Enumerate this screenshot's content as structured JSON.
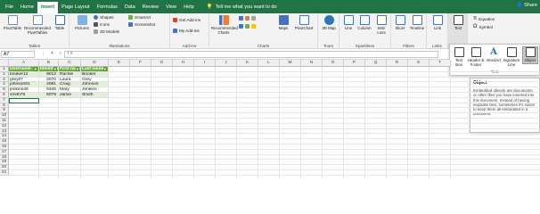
{
  "tabs": [
    "File",
    "Home",
    "Insert",
    "Page Layout",
    "Formulas",
    "Data",
    "Review",
    "View",
    "Help"
  ],
  "tell_me": "Tell me what you want to do",
  "share": "Share",
  "ribbon": {
    "tables": {
      "pivot": "PivotTable",
      "recommended": "Recommended PivotTables",
      "table": "Table",
      "label": "Tables"
    },
    "illustrations": {
      "pictures": "Pictures",
      "shapes": "Shapes",
      "icons": "Icons",
      "models": "3D Models",
      "smartart": "SmartArt",
      "screenshot": "Screenshot",
      "label": "Illustrations"
    },
    "addins": {
      "get": "Get Add-ins",
      "my": "My Add-ins",
      "label": "Add-ins"
    },
    "charts": {
      "recommended": "Recommended Charts",
      "maps": "Maps",
      "pivotchart": "PivotChart",
      "label": "Charts"
    },
    "tours": {
      "map3d": "3D Map",
      "label": "Tours"
    },
    "sparklines": {
      "line": "Line",
      "column": "Column",
      "winloss": "Win/ Loss",
      "label": "Sparklines"
    },
    "filters": {
      "slicer": "Slicer",
      "timeline": "Timeline",
      "label": "Filters"
    },
    "links": {
      "link": "Link",
      "label": "Links"
    },
    "text": {
      "text": "Text"
    },
    "symbols": {
      "equation": "Equation",
      "symbol": "Symbol",
      "label": "Symbols"
    }
  },
  "text_panel": {
    "items": [
      "Text Box",
      "Header & Footer",
      "WordArt",
      "Signature Line",
      "Object"
    ],
    "label": "Text"
  },
  "tooltip": {
    "title": "Object",
    "body": "Embedded objects are documents or other files you have inserted into this document. Instead of having separate files, sometimes it's easier to keep them all embedded in a document."
  },
  "formula_bar": {
    "name_box": "A7",
    "fx": "⋮ ✕ ✓ fx"
  },
  "columns": [
    "A",
    "B",
    "C",
    "D",
    "E",
    "F",
    "G",
    "H",
    "I",
    "J",
    "K",
    "L",
    "M",
    "N",
    "O",
    "P",
    "Q",
    "R",
    "S",
    "T"
  ],
  "rows": [
    "1",
    "2",
    "3",
    "4",
    "5",
    "6",
    "7",
    "8",
    "9",
    "10",
    "11",
    "12",
    "13",
    "14",
    "15",
    "16",
    "17",
    "18",
    "19",
    "20",
    "21",
    "22",
    "23"
  ],
  "table": {
    "headers": [
      "Username",
      "Identifier",
      "First name",
      "Last name"
    ],
    "data": [
      [
        "booker12",
        "9012",
        "Rachel",
        "Booker"
      ],
      [
        "grey07",
        "2070",
        "Laura",
        "Grey"
      ],
      [
        "johnson81",
        "4081",
        "Craig",
        "Johnson"
      ],
      [
        "jenkins46",
        "9346",
        "Mary",
        "Jenkins"
      ],
      [
        "smith79",
        "5079",
        "Jamie",
        "Smith"
      ]
    ]
  },
  "colors": {
    "excel_green": "#217346",
    "table_header": "#70ad47",
    "table_band": "#e2efda"
  }
}
